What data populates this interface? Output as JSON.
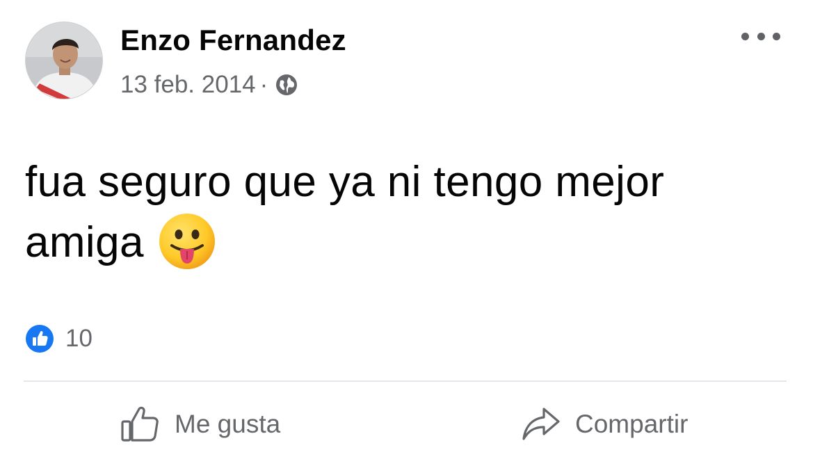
{
  "post": {
    "author": "Enzo Fernandez",
    "date": "13 feb. 2014",
    "separator": "·",
    "visibility_icon": "globe-icon",
    "text": "fua seguro que ya ni tengo mejor amiga",
    "emoji": "😛",
    "reactions": {
      "icon": "like-reaction-icon",
      "count": "10"
    }
  },
  "actions": {
    "like_label": "Me gusta",
    "share_label": "Compartir"
  },
  "colors": {
    "like_blue": "#1877f2",
    "secondary_text": "#65676b",
    "primary_text": "#050505",
    "divider": "#e4e6eb"
  }
}
